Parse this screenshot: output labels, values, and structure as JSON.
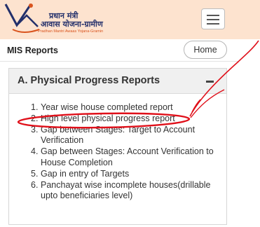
{
  "header": {
    "logo": {
      "line1": "प्रधान मंत्री",
      "line2": "आवास योजना-ग्रामीण",
      "line3": "Pradhan Mantri Awaas Yojana-Gramin"
    },
    "menu_icon": "hamburger-menu-icon"
  },
  "subheader": {
    "title": "MIS Reports",
    "home_label": "Home"
  },
  "panel": {
    "title": "A. Physical Progress Reports",
    "collapse_icon": "minus-icon",
    "items": [
      {
        "num": "1.",
        "label": "Year wise house completed report"
      },
      {
        "num": "2.",
        "label": "High level physical progress report"
      },
      {
        "num": "3.",
        "label": "Gap between Stages: Target to Account Verification"
      },
      {
        "num": "4.",
        "label": "Gap between Stages: Account Verification to House Completion"
      },
      {
        "num": "5.",
        "label": "Gap in entry of Targets"
      },
      {
        "num": "6.",
        "label": "Panchayat wise incomplete houses(drillable upto beneficiaries level)"
      }
    ]
  },
  "annotation": {
    "color": "#e0101a",
    "highlighted_item": 2
  },
  "colors": {
    "header_bg": "#fde3cf",
    "logo_text": "#23306b",
    "logo_accent": "#d9541e"
  }
}
